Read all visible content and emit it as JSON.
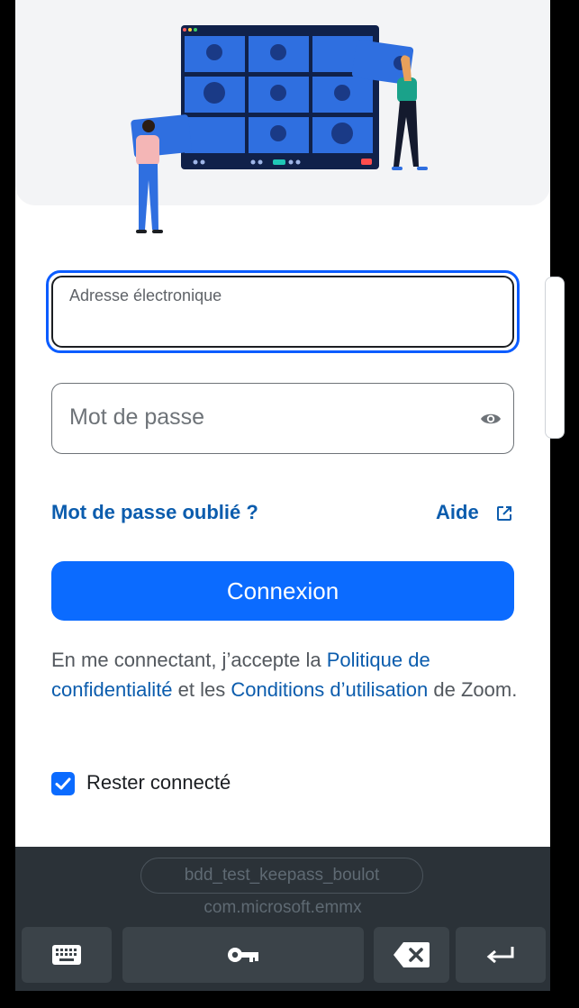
{
  "form": {
    "email_label": "Adresse électronique",
    "password_placeholder": "Mot de passe",
    "forgot_password": "Mot de passe oublié ?",
    "help": "Aide",
    "sign_in_button": "Connexion",
    "legal": {
      "prefix": "En me connectant, j’accepte la ",
      "privacy_link": "Politique de confidentialité",
      "middle": " et les ",
      "terms_link": "Conditions d’utilisation",
      "suffix": " de Zoom."
    },
    "stay_signed_in": "Rester connecté",
    "stay_signed_in_checked": true
  },
  "keyboard": {
    "suggestion": "bdd_test_keepass_boulot",
    "package": "com.microsoft.emmx",
    "keys": [
      "keyboard-icon",
      "key-icon",
      "backspace-icon",
      "enter-icon"
    ]
  },
  "colors": {
    "primary": "#0B6BFF",
    "link": "#0B5CAD",
    "hero_bg": "#F3F4F6",
    "keyboard_bg": "#2B3238"
  }
}
